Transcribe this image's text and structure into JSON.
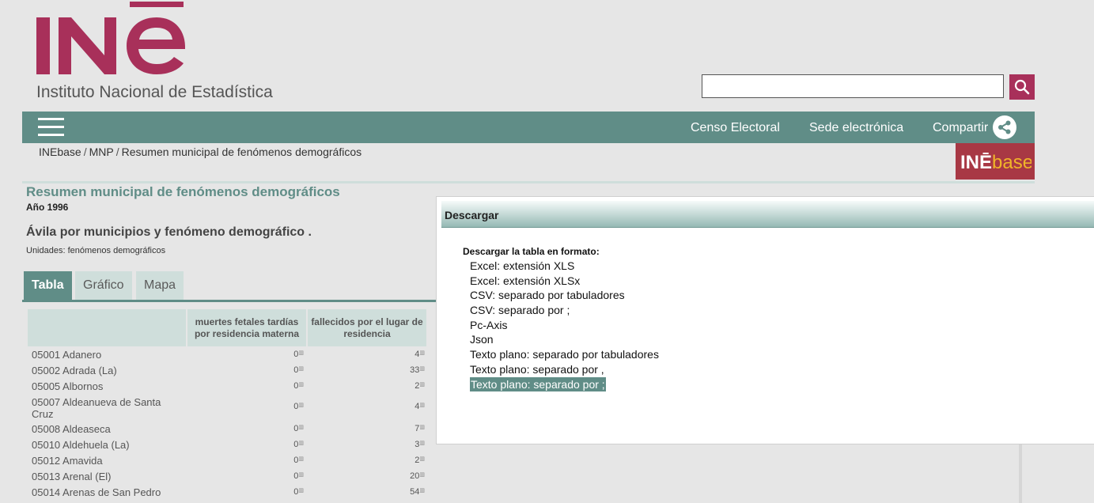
{
  "header": {
    "logo_text": "INE",
    "institute_name": "Instituto Nacional de Estadística",
    "search": {
      "value": "",
      "placeholder": ""
    }
  },
  "nav": {
    "links": [
      "Censo Electoral",
      "Sede electrónica",
      "Compartir"
    ]
  },
  "breadcrumb": [
    "INEbase",
    "MNP",
    "Resumen municipal de fenómenos demográficos"
  ],
  "inebase_logo_text": "INEbase",
  "page": {
    "title": "Resumen municipal de fenómenos demográficos",
    "year": "Año 1996",
    "subtitle": "Ávila por municipios y fenómeno demográfico .",
    "units": "Unidades: fenómenos demográficos"
  },
  "tabs": [
    "Tabla",
    "Gráfico",
    "Mapa"
  ],
  "table": {
    "headers": [
      "muertes fetales tardías por residencia materna",
      "fallecidos por el lugar de residencia"
    ],
    "rows": [
      {
        "name": "05001 Adanero",
        "v1": "0",
        "v2": "4"
      },
      {
        "name": "05002 Adrada (La)",
        "v1": "0",
        "v2": "33"
      },
      {
        "name": "05005 Albornos",
        "v1": "0",
        "v2": "2"
      },
      {
        "name": "05007 Aldeanueva de Santa Cruz",
        "v1": "0",
        "v2": "4"
      },
      {
        "name": "05008 Aldeaseca",
        "v1": "0",
        "v2": "7"
      },
      {
        "name": "05010 Aldehuela (La)",
        "v1": "0",
        "v2": "3"
      },
      {
        "name": "05012 Amavida",
        "v1": "0",
        "v2": "2"
      },
      {
        "name": "05013 Arenal (El)",
        "v1": "0",
        "v2": "20"
      },
      {
        "name": "05014 Arenas de San Pedro",
        "v1": "0",
        "v2": "54"
      }
    ]
  },
  "modal": {
    "title": "Descargar",
    "label": "Descargar la tabla en formato:",
    "options": [
      "Excel: extensión XLS",
      "Excel: extensión XLSx",
      "CSV: separado por tabuladores",
      "CSV: separado por ;",
      "Pc-Axis",
      "Json",
      "Texto plano: separado por tabuladores",
      "Texto plano: separado por ,",
      "Texto plano: separado por ;"
    ],
    "selected_index": 8
  },
  "colors": {
    "brand": "#a8305a",
    "nav": "#608d87",
    "tab_light": "#cfdedb"
  },
  "icons": [
    "search-icon",
    "hamburger-icon",
    "share-icon"
  ]
}
